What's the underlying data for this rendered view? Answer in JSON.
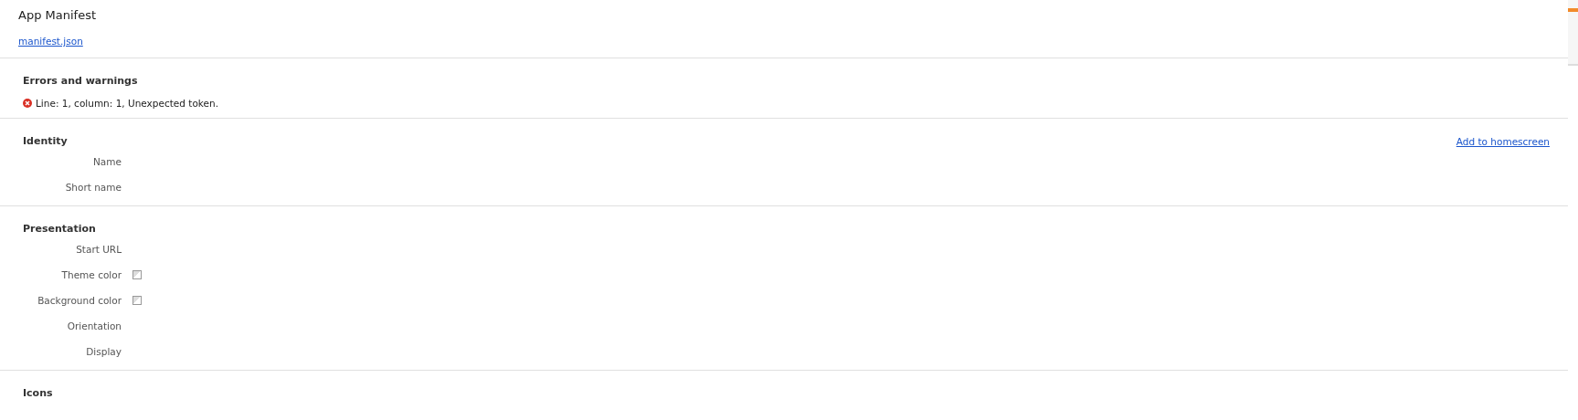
{
  "header": {
    "title": "App Manifest",
    "link": "manifest.json"
  },
  "sections": [
    {
      "title": "Errors and warnings",
      "errors": [
        {
          "text": "Line: 1, column: 1, Unexpected token."
        }
      ]
    },
    {
      "title": "Identity",
      "action": "Add to homescreen",
      "fields": [
        {
          "label": "Name",
          "kind": "text"
        },
        {
          "label": "Short name",
          "kind": "text"
        }
      ]
    },
    {
      "title": "Presentation",
      "fields": [
        {
          "label": "Start URL",
          "kind": "text"
        },
        {
          "label": "Theme color",
          "kind": "color"
        },
        {
          "label": "Background color",
          "kind": "color"
        },
        {
          "label": "Orientation",
          "kind": "text"
        },
        {
          "label": "Display",
          "kind": "text"
        }
      ]
    },
    {
      "title": "Icons"
    }
  ]
}
